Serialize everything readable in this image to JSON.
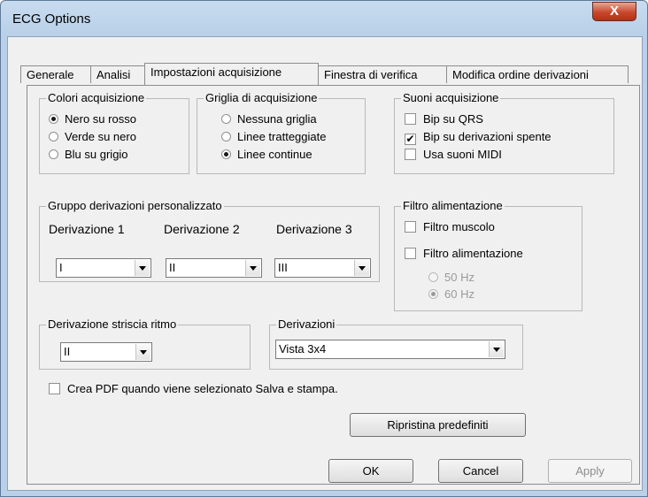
{
  "window": {
    "title": "ECG Options",
    "close_glyph": "X"
  },
  "tabs": [
    "Generale",
    "Analisi",
    "Impostazioni acquisizione",
    "Finestra di verifica",
    "Modifica ordine derivazioni"
  ],
  "colors_group": {
    "title": "Colori acquisizione",
    "options": [
      "Nero su rosso",
      "Verde su nero",
      "Blu su grigio"
    ],
    "selected": 0
  },
  "grid_group": {
    "title": "Griglia di acquisizione",
    "options": [
      "Nessuna griglia",
      "Linee tratteggiate",
      "Linee continue"
    ],
    "selected": 2
  },
  "sounds_group": {
    "title": "Suoni acquisizione",
    "items": [
      {
        "label": "Bip su QRS",
        "checked": false
      },
      {
        "label": "Bip su derivazioni spente",
        "checked": true
      },
      {
        "label": "Usa suoni MIDI",
        "checked": false
      }
    ]
  },
  "custom_leads": {
    "title": "Gruppo derivazioni personalizzato",
    "columns": [
      {
        "label": "Derivazione 1",
        "value": "I"
      },
      {
        "label": "Derivazione 2",
        "value": "II"
      },
      {
        "label": "Derivazione 3",
        "value": "III"
      }
    ]
  },
  "power_filter": {
    "title": "Filtro alimentazione",
    "muscle": "Filtro muscolo",
    "power": "Filtro alimentazione",
    "hz_options": [
      "50 Hz",
      "60 Hz"
    ],
    "hz_selected": 1
  },
  "rhythm": {
    "title": "Derivazione striscia ritmo",
    "value": "II"
  },
  "leads": {
    "title": "Derivazioni",
    "value": "Vista 3x4"
  },
  "pdf_check": {
    "label": "Crea PDF quando viene selezionato Salva e stampa.",
    "checked": false
  },
  "buttons": {
    "restore": "Ripristina predefiniti",
    "ok": "OK",
    "cancel": "Cancel",
    "apply": "Apply"
  }
}
